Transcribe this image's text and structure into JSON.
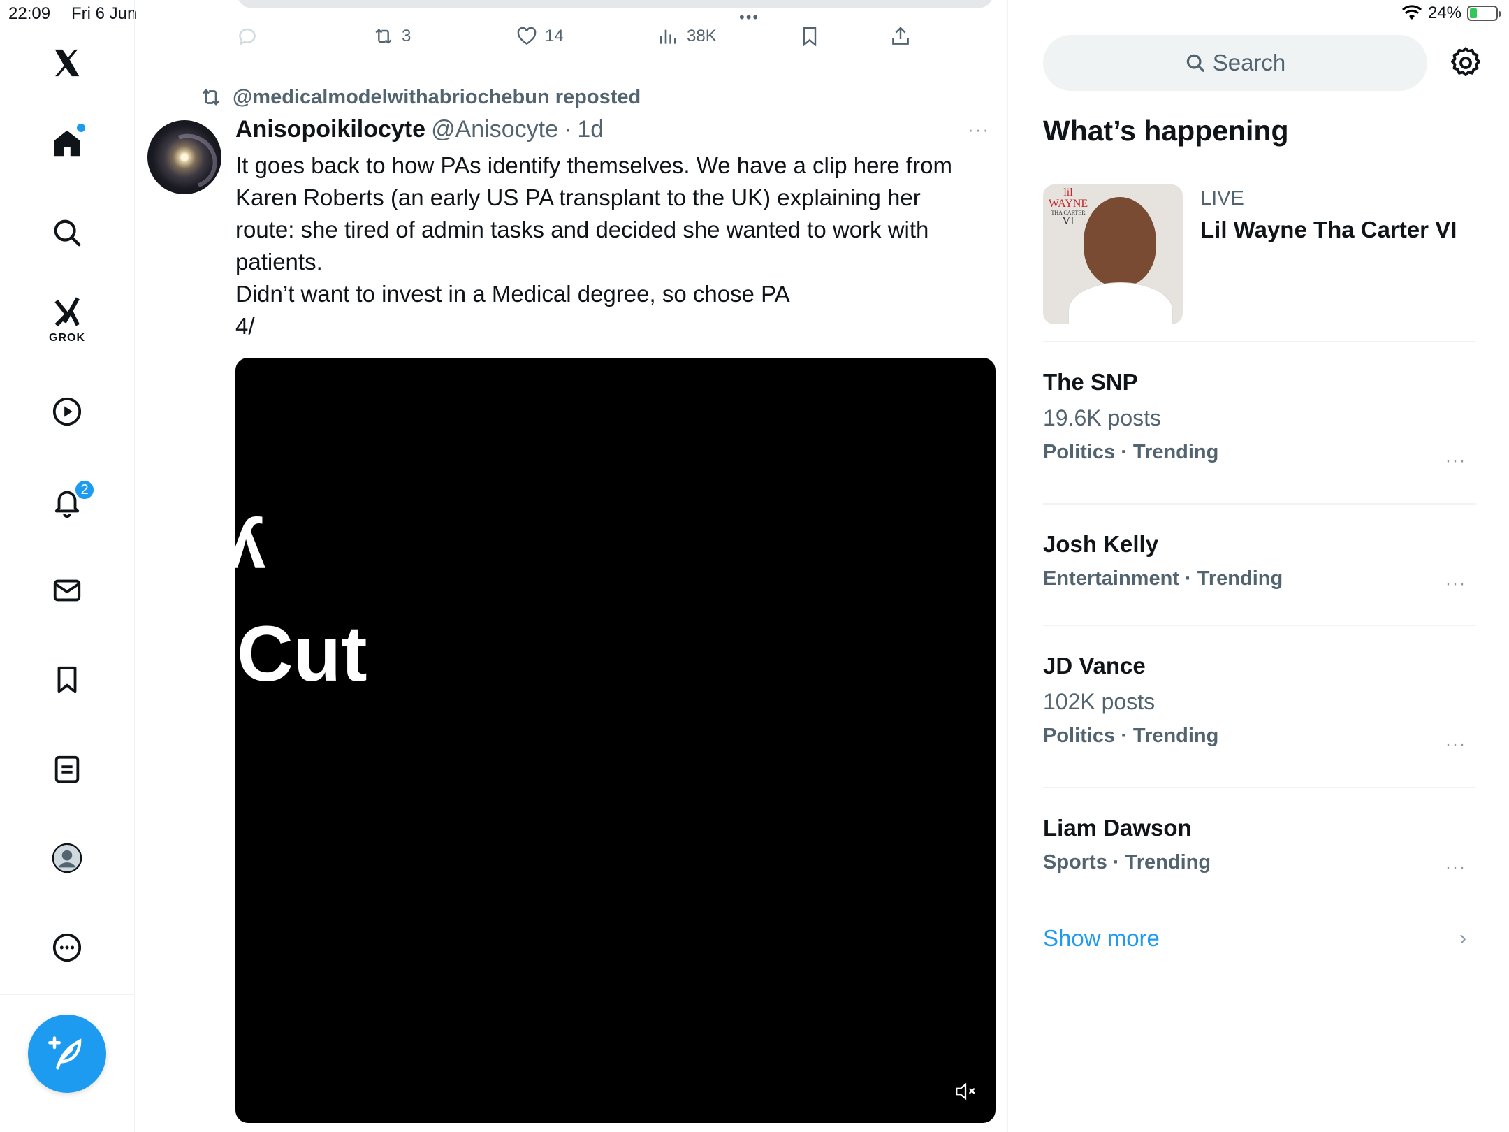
{
  "status_bar": {
    "time": "22:09",
    "date": "Fri 6 Jun",
    "battery": "24%",
    "battery_fraction": 0.24
  },
  "nav": {
    "items": [
      "x-logo",
      "home-icon",
      "search-icon",
      "grok-icon",
      "video-icon",
      "bell-icon",
      "mail-icon",
      "bookmark-icon",
      "list-icon",
      "profile-icon",
      "more-icon"
    ],
    "grok_label": "GROK",
    "notifications_badge": "2",
    "compose_icon": "feather-plus-icon"
  },
  "prev_tweet": {
    "retweets": "3",
    "likes": "14",
    "views": "38K"
  },
  "tweet": {
    "repost_by": "@medicalmodelwithabriochebun reposted",
    "name": "Anisopoikilocyte",
    "handle": "@Anisocyte",
    "dot": "·",
    "time": "1d",
    "more": "···",
    "lines": [
      "It goes back to how PAs identify themselves. We have a clip here from Karen Roberts (an early US PA transplant to the UK) explaining her route: she tired of admin tasks and decided she wanted to work with patients.",
      "Didn’t want to invest in a Medical degree, so chose PA",
      "4/"
    ],
    "video_text_top": "y",
    "video_text": "Cut"
  },
  "right": {
    "search_placeholder": "Search",
    "section_title": "What’s happening",
    "live": {
      "label": "LIVE",
      "title": "Lil Wayne Tha Carter VI",
      "thumb_text": [
        "lil",
        "WAYNE",
        "THA CARTER",
        "VI"
      ]
    },
    "trends": [
      {
        "name": "The SNP",
        "posts": "19.6K posts",
        "category": "Politics · Trending"
      },
      {
        "name": "Josh Kelly",
        "posts": "",
        "category": "Entertainment · Trending"
      },
      {
        "name": "JD Vance",
        "posts": "102K posts",
        "category": "Politics · Trending"
      },
      {
        "name": "Liam Dawson",
        "posts": "",
        "category": "Sports · Trending"
      }
    ],
    "trend_more": "···",
    "show_more": "Show more",
    "chevron": "›"
  },
  "colors": {
    "accent": "#1d9bf0",
    "text": "#0f1419",
    "muted": "#536471",
    "border": "#eff3f4"
  }
}
